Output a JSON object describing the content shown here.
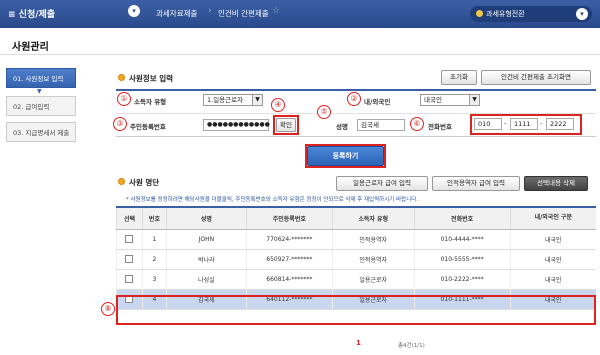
{
  "top": {
    "menu_title": "≡ 신청/제출",
    "breadcrumb": [
      "과세자료제출",
      "인건비 간편제출"
    ],
    "guide_button": "과세유형전환"
  },
  "page_title": "사원관리",
  "sidebar": {
    "items": [
      {
        "label": "01. 사원정보 입력"
      },
      {
        "label": "02. 급여입력"
      },
      {
        "label": "03. 지급명세서 제출"
      }
    ]
  },
  "form": {
    "section_title": "사원정보 입력",
    "reset_button": "초기화",
    "reset_screen_button": "인건비 간편제출 초기화면",
    "fields": {
      "income_type_label": "소득자 유형",
      "income_type_value": "1.일용근로자",
      "nationality_label": "내/외국인",
      "nationality_value": "내국인",
      "rrn_label": "주민등록번호",
      "rrn_value": "●●●●●●●●●●●●",
      "rrn_confirm_button": "확인",
      "name_label": "성명",
      "name_value": "김국세",
      "phone_label": "전화번호",
      "phone_1": "010",
      "phone_2": "1111",
      "phone_3": "2222",
      "phone_dash": "-"
    },
    "register_button": "등록하기"
  },
  "markers": [
    "①",
    "②",
    "③",
    "④",
    "⑤",
    "⑥",
    "⑦",
    "⑧"
  ],
  "list": {
    "section_title": "사원 명단",
    "btn_daily": "일용근로자 급여 입력",
    "btn_business": "인적용역자 급여 입력",
    "btn_delete": "선택내용 삭제",
    "note": "* 사원정보를 정정하려면 해당사원을 더블클릭, 주민등록번호와 소득자 유형은 정정이 안되므로 삭제 후 재입력하시기 바랍니다.",
    "headers": [
      "선택",
      "번호",
      "성명",
      "주민등록번호",
      "소득자 유형",
      "전화번호",
      "내/외국인 구분"
    ],
    "rows": [
      {
        "no": "1",
        "name": "JOHN",
        "rrn": "770624-*******",
        "type": "인적용역자",
        "phone": "010-4444-****",
        "nat": "내국인"
      },
      {
        "no": "2",
        "name": "박나라",
        "rrn": "650927-*******",
        "type": "인적용역자",
        "phone": "010-5555-****",
        "nat": "내국인"
      },
      {
        "no": "3",
        "name": "나성실",
        "rrn": "660814-*******",
        "type": "일용근로자",
        "phone": "010-2222-****",
        "nat": "내국인"
      },
      {
        "no": "4",
        "name": "김국세",
        "rrn": "640112-*******",
        "type": "일용근로자",
        "phone": "010-1111-****",
        "nat": "내국인"
      }
    ]
  },
  "pager": {
    "current": "1",
    "total": "총4건(1/1)"
  },
  "colors": {
    "accent": "#3b5fa5",
    "marker": "#d22"
  }
}
